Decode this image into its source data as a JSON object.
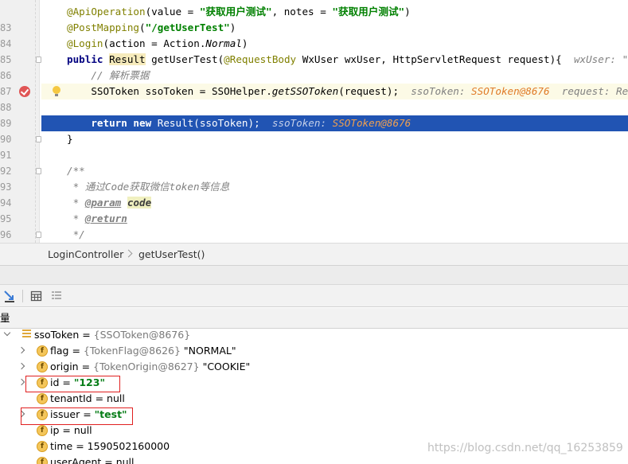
{
  "editor": {
    "lines": [
      {
        "no": "",
        "tokens": [
          [
            "a",
            "@ApiOperation"
          ],
          [
            "",
            "(value = "
          ],
          [
            "s",
            "\"获取用户测试\""
          ],
          [
            "",
            ", notes = "
          ],
          [
            "s",
            "\"获取用户测试\""
          ],
          [
            "",
            ")"
          ]
        ]
      },
      {
        "no": "83",
        "tokens": [
          [
            "a",
            "@PostMapping"
          ],
          [
            "",
            "("
          ],
          [
            "s",
            "\"/getUserTest\""
          ],
          [
            "",
            ")"
          ]
        ]
      },
      {
        "no": "84",
        "tokens": [
          [
            "a",
            "@Login"
          ],
          [
            "",
            "(action = Action."
          ],
          [
            "it",
            "Normal"
          ],
          [
            "",
            ")"
          ]
        ]
      },
      {
        "no": "85",
        "tokens": [
          [
            "k",
            "public "
          ],
          [
            "hl",
            "Result"
          ],
          [
            "",
            " getUserTest("
          ],
          [
            "a",
            "@RequestBody"
          ],
          [
            "",
            " WxUser wxUser, HttpServletRequest request){  "
          ],
          [
            "hint",
            "wxUser: \"WxUser(n"
          ]
        ]
      },
      {
        "no": "86",
        "tokens": [
          [
            "cm",
            "    // 解析票据"
          ]
        ]
      },
      {
        "no": "87",
        "tokens": [
          [
            "",
            "    SSOToken ssoToken = SSOHelper."
          ],
          [
            "it",
            "getSSOToken"
          ],
          [
            "",
            "(request);  "
          ],
          [
            "hint",
            "ssoToken: "
          ],
          [
            "hintval",
            "SSOToken@8676"
          ],
          [
            "hint",
            "  request: RequestFac"
          ]
        ]
      },
      {
        "no": "88",
        "tokens": []
      },
      {
        "no": "89",
        "tokens": [
          [
            "",
            "    "
          ],
          [
            "k",
            "return new "
          ],
          [
            "",
            "Result(ssoToken);  "
          ],
          [
            "hint",
            "ssoToken: "
          ],
          [
            "hintval",
            "SSOToken@8676"
          ]
        ]
      },
      {
        "no": "90",
        "tokens": [
          [
            "",
            "}"
          ]
        ]
      },
      {
        "no": "91",
        "tokens": []
      },
      {
        "no": "92",
        "tokens": [
          [
            "cm",
            "/**"
          ]
        ]
      },
      {
        "no": "93",
        "tokens": [
          [
            "cm",
            " * 通过Code获取微信token等信息"
          ]
        ]
      },
      {
        "no": "94",
        "tokens": [
          [
            "cm",
            " * "
          ],
          [
            "doctag",
            "@param"
          ],
          [
            "cm",
            " "
          ],
          [
            "docparam",
            "code"
          ]
        ]
      },
      {
        "no": "95",
        "tokens": [
          [
            "cm",
            " * "
          ],
          [
            "doctag",
            "@return"
          ]
        ]
      },
      {
        "no": "96",
        "tokens": [
          [
            "cm",
            " */"
          ]
        ]
      }
    ]
  },
  "breadcrumb": [
    "LoginController",
    "getUserTest()"
  ],
  "toolbar": {
    "icons": [
      "step-into-icon",
      "table-view-icon",
      "flatten-icon"
    ]
  },
  "variables": {
    "title": "量",
    "rows": [
      {
        "name": "ssoToken",
        "sep": " = ",
        "meta": "{SSOToken@8676}",
        "value": "",
        "kind": "root"
      },
      {
        "name": "flag",
        "sep": " = ",
        "meta": "{TokenFlag@8626}",
        "value": " \"NORMAL\"",
        "kind": "obj"
      },
      {
        "name": "origin",
        "sep": " = ",
        "meta": "{TokenOrigin@8627}",
        "value": " \"COOKIE\"",
        "kind": "obj"
      },
      {
        "name": "id",
        "sep": " = ",
        "meta": "",
        "value": "\"123\"",
        "kind": "str"
      },
      {
        "name": "tenantId",
        "sep": " = ",
        "meta": "",
        "value": "null",
        "kind": "plain"
      },
      {
        "name": "issuer",
        "sep": " = ",
        "meta": "",
        "value": "\"test\"",
        "kind": "str"
      },
      {
        "name": "ip",
        "sep": " = ",
        "meta": "",
        "value": "null",
        "kind": "plain"
      },
      {
        "name": "time",
        "sep": " = ",
        "meta": "",
        "value": "1590502160000",
        "kind": "plain"
      },
      {
        "name": "userAgent",
        "sep": " = ",
        "meta": "",
        "value": "null",
        "kind": "plain"
      }
    ]
  },
  "watermark": "https://blog.csdn.net/qq_16253859",
  "colors": {
    "execution_line": "#2154b3",
    "highlight_box": "#e02020",
    "string_value": "#067d17"
  }
}
